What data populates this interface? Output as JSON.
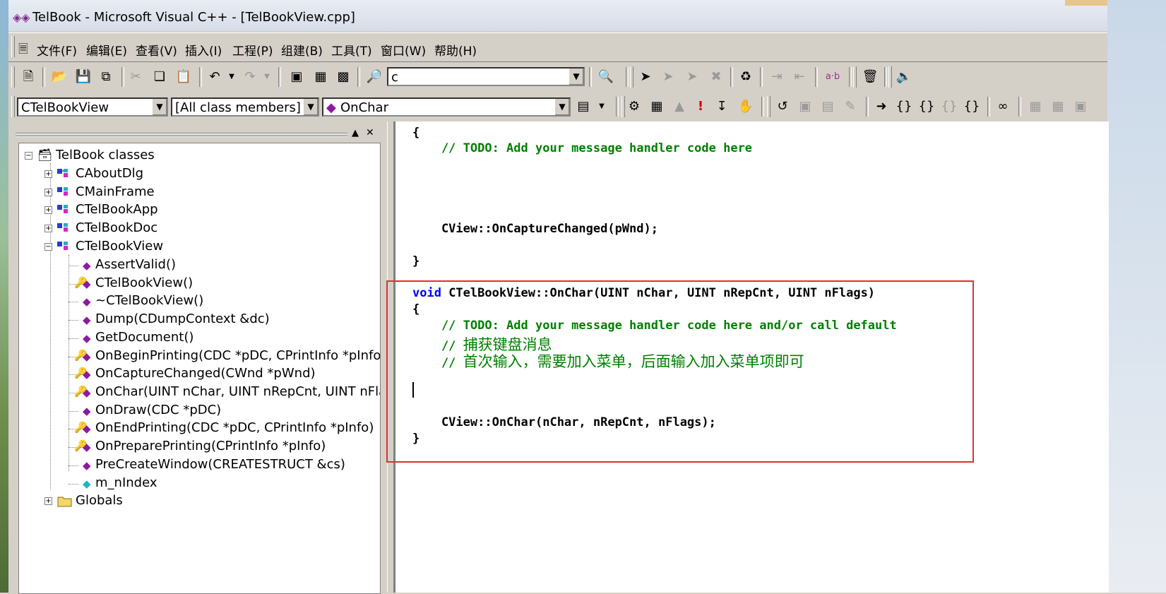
{
  "window": {
    "title": "TelBook - Microsoft Visual C++ - [TelBookView.cpp]",
    "logo_icon": "vc-logo-icon"
  },
  "menubar": {
    "items": [
      {
        "label": "文件(F)"
      },
      {
        "label": "编辑(E)"
      },
      {
        "label": "查看(V)"
      },
      {
        "label": "插入(I)"
      },
      {
        "label": "工程(P)"
      },
      {
        "label": "组建(B)"
      },
      {
        "label": "工具(T)"
      },
      {
        "label": "窗口(W)"
      },
      {
        "label": "帮助(H)"
      }
    ]
  },
  "toolbar1": {
    "find_combo_value": "c",
    "ab_label": "a·b"
  },
  "toolbar2": {
    "class_combo": "CTelBookView",
    "filter_combo": "[All class members]",
    "member_combo": "OnChar"
  },
  "classview": {
    "root": "TelBook classes",
    "classes": [
      "CAboutDlg",
      "CMainFrame",
      "CTelBookApp",
      "CTelBookDoc",
      "CTelBookView"
    ],
    "members": [
      {
        "label": "AssertValid()",
        "icon": "method-icon"
      },
      {
        "label": "CTelBookView()",
        "icon": "protected-method-icon"
      },
      {
        "label": "~CTelBookView()",
        "icon": "method-icon"
      },
      {
        "label": "Dump(CDumpContext &dc)",
        "icon": "method-icon"
      },
      {
        "label": "GetDocument()",
        "icon": "method-icon"
      },
      {
        "label": "OnBeginPrinting(CDC *pDC, CPrintInfo *pInfo)",
        "icon": "protected-method-icon"
      },
      {
        "label": "OnCaptureChanged(CWnd *pWnd)",
        "icon": "protected-method-icon"
      },
      {
        "label": "OnChar(UINT nChar, UINT nRepCnt, UINT nFlags)",
        "icon": "protected-method-icon"
      },
      {
        "label": "OnDraw(CDC *pDC)",
        "icon": "method-icon"
      },
      {
        "label": "OnEndPrinting(CDC *pDC, CPrintInfo *pInfo)",
        "icon": "protected-method-icon"
      },
      {
        "label": "OnPreparePrinting(CPrintInfo *pInfo)",
        "icon": "protected-method-icon"
      },
      {
        "label": "PreCreateWindow(CREATESTRUCT &cs)",
        "icon": "method-icon"
      },
      {
        "label": "m_nIndex",
        "icon": "member-variable-icon"
      }
    ],
    "globals": "Globals"
  },
  "editor": {
    "lines": {
      "l1": "{",
      "l2": "    // TODO: Add your message handler code here",
      "l3": "    CView::OnCaptureChanged(pWnd);",
      "l4": "}",
      "l5_kw": "void",
      "l5_rest": " CTelBookView::OnChar(UINT nChar, UINT nRepCnt, UINT nFlags)",
      "l6": "{",
      "l7": "    // TODO: Add your message handler code here and/or call default",
      "l8_prefix": "    // ",
      "l8_cn": "捕获键盘消息",
      "l9_prefix": "    // ",
      "l9_cn": "首次输入，需要加入菜单，后面输入加入菜单项即可",
      "l10": "    CView::OnChar(nChar, nRepCnt, nFlags);",
      "l11": "}"
    }
  },
  "colors": {
    "comment": "#008000",
    "keyword": "#0000ff",
    "highlight_border": "#e03030"
  }
}
